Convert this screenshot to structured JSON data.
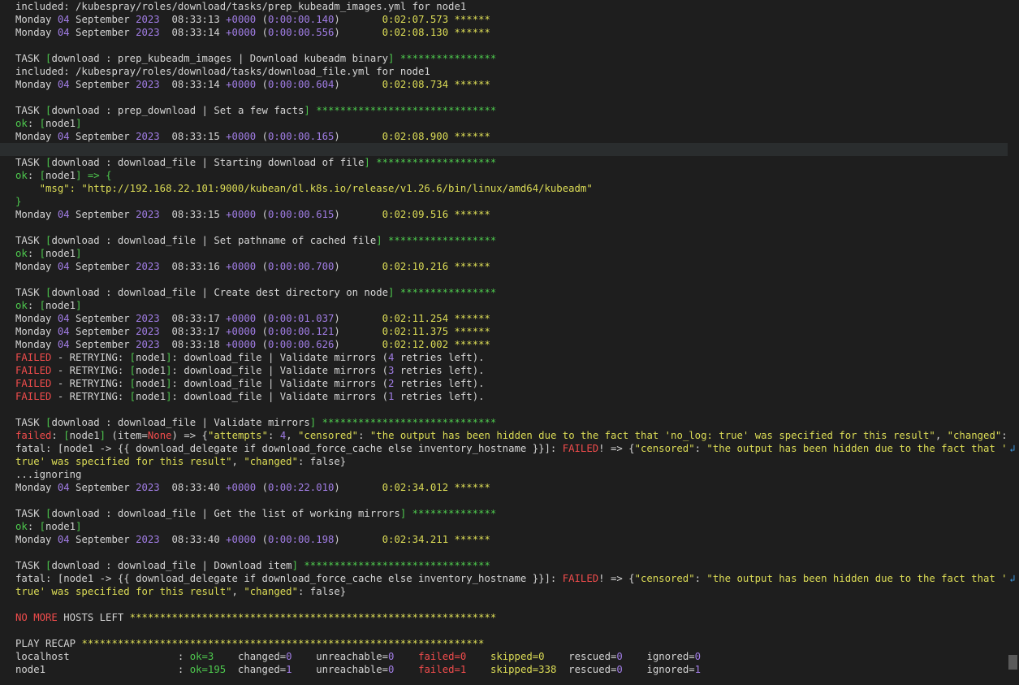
{
  "palette": {
    "default": "#d4d4d4",
    "green": "#4ec94e",
    "yellow": "#dcdc56",
    "purple": "#a17de5",
    "blue": "#3a96dd",
    "red": "#f14c4c",
    "orange": "#ce9178"
  },
  "wrap_glyph": "↲",
  "lines": [
    [
      [
        "d",
        "included: /kubespray/roles/download/tasks/prep_kubeadm_images.yml for node1"
      ]
    ],
    [
      [
        "d",
        "Monday "
      ],
      [
        "p",
        "04"
      ],
      [
        "d",
        " September "
      ],
      [
        "p",
        "2023"
      ],
      [
        "d",
        "  08:33:13 "
      ],
      [
        "p",
        "+0000"
      ],
      [
        "d",
        " ("
      ],
      [
        "p",
        "0:00:00.140"
      ],
      [
        "d",
        ")       "
      ],
      [
        "y",
        "0:02:07.573 ******"
      ]
    ],
    [
      [
        "d",
        "Monday "
      ],
      [
        "p",
        "04"
      ],
      [
        "d",
        " September "
      ],
      [
        "p",
        "2023"
      ],
      [
        "d",
        "  08:33:14 "
      ],
      [
        "p",
        "+0000"
      ],
      [
        "d",
        " ("
      ],
      [
        "p",
        "0:00:00.556"
      ],
      [
        "d",
        ")       "
      ],
      [
        "y",
        "0:02:08.130 ******"
      ]
    ],
    [],
    [
      [
        "d",
        "TASK "
      ],
      [
        "g",
        "["
      ],
      [
        "d",
        "download : prep_kubeadm_images | Download kubeadm binary"
      ],
      [
        "g",
        "] ****************"
      ]
    ],
    [
      [
        "d",
        "included: /kubespray/roles/download/tasks/download_file.yml for node1"
      ]
    ],
    [
      [
        "d",
        "Monday "
      ],
      [
        "p",
        "04"
      ],
      [
        "d",
        " September "
      ],
      [
        "p",
        "2023"
      ],
      [
        "d",
        "  08:33:14 "
      ],
      [
        "p",
        "+0000"
      ],
      [
        "d",
        " ("
      ],
      [
        "p",
        "0:00:00.604"
      ],
      [
        "d",
        ")       "
      ],
      [
        "y",
        "0:02:08.734 ******"
      ]
    ],
    [],
    [
      [
        "d",
        "TASK "
      ],
      [
        "g",
        "["
      ],
      [
        "d",
        "download : prep_download | Set a few facts"
      ],
      [
        "g",
        "] ******************************"
      ]
    ],
    [
      [
        "g",
        "ok"
      ],
      [
        "d",
        ": "
      ],
      [
        "g",
        "["
      ],
      [
        "d",
        "node1"
      ],
      [
        "g",
        "]"
      ]
    ],
    [
      [
        "d",
        "Monday "
      ],
      [
        "p",
        "04"
      ],
      [
        "d",
        " September "
      ],
      [
        "p",
        "2023"
      ],
      [
        "d",
        "  08:33:15 "
      ],
      [
        "p",
        "+0000"
      ],
      [
        "d",
        " ("
      ],
      [
        "p",
        "0:00:00.165"
      ],
      [
        "d",
        ")       "
      ],
      [
        "y",
        "0:02:08.900 ******"
      ]
    ],
    [],
    [
      [
        "d",
        "TASK "
      ],
      [
        "g",
        "["
      ],
      [
        "d",
        "download : download_file | Starting download of file"
      ],
      [
        "g",
        "] ********************"
      ]
    ],
    [
      [
        "g",
        "ok"
      ],
      [
        "d",
        ": "
      ],
      [
        "g",
        "["
      ],
      [
        "d",
        "node1"
      ],
      [
        "g",
        "] => {"
      ]
    ],
    [
      [
        "y",
        "    \"msg\": \"http://192.168.22.101:9000/kubean/dl.k8s.io/release/v1.26.6/bin/linux/amd64/kubeadm\""
      ]
    ],
    [
      [
        "g",
        "}"
      ]
    ],
    [
      [
        "d",
        "Monday "
      ],
      [
        "p",
        "04"
      ],
      [
        "d",
        " September "
      ],
      [
        "p",
        "2023"
      ],
      [
        "d",
        "  08:33:15 "
      ],
      [
        "p",
        "+0000"
      ],
      [
        "d",
        " ("
      ],
      [
        "p",
        "0:00:00.615"
      ],
      [
        "d",
        ")       "
      ],
      [
        "y",
        "0:02:09.516 ******"
      ]
    ],
    [],
    [
      [
        "d",
        "TASK "
      ],
      [
        "g",
        "["
      ],
      [
        "d",
        "download : download_file | Set pathname of cached file"
      ],
      [
        "g",
        "] ******************"
      ]
    ],
    [
      [
        "g",
        "ok"
      ],
      [
        "d",
        ": "
      ],
      [
        "g",
        "["
      ],
      [
        "d",
        "node1"
      ],
      [
        "g",
        "]"
      ]
    ],
    [
      [
        "d",
        "Monday "
      ],
      [
        "p",
        "04"
      ],
      [
        "d",
        " September "
      ],
      [
        "p",
        "2023"
      ],
      [
        "d",
        "  08:33:16 "
      ],
      [
        "p",
        "+0000"
      ],
      [
        "d",
        " ("
      ],
      [
        "p",
        "0:00:00.700"
      ],
      [
        "d",
        ")       "
      ],
      [
        "y",
        "0:02:10.216 ******"
      ]
    ],
    [],
    [
      [
        "d",
        "TASK "
      ],
      [
        "g",
        "["
      ],
      [
        "d",
        "download : download_file | Create dest directory on node"
      ],
      [
        "g",
        "] ****************"
      ]
    ],
    [
      [
        "g",
        "ok"
      ],
      [
        "d",
        ": "
      ],
      [
        "g",
        "["
      ],
      [
        "d",
        "node1"
      ],
      [
        "g",
        "]"
      ]
    ],
    [
      [
        "d",
        "Monday "
      ],
      [
        "p",
        "04"
      ],
      [
        "d",
        " September "
      ],
      [
        "p",
        "2023"
      ],
      [
        "d",
        "  08:33:17 "
      ],
      [
        "p",
        "+0000"
      ],
      [
        "d",
        " ("
      ],
      [
        "p",
        "0:00:01.037"
      ],
      [
        "d",
        ")       "
      ],
      [
        "y",
        "0:02:11.254 ******"
      ]
    ],
    [
      [
        "d",
        "Monday "
      ],
      [
        "p",
        "04"
      ],
      [
        "d",
        " September "
      ],
      [
        "p",
        "2023"
      ],
      [
        "d",
        "  08:33:17 "
      ],
      [
        "p",
        "+0000"
      ],
      [
        "d",
        " ("
      ],
      [
        "p",
        "0:00:00.121"
      ],
      [
        "d",
        ")       "
      ],
      [
        "y",
        "0:02:11.375 ******"
      ]
    ],
    [
      [
        "d",
        "Monday "
      ],
      [
        "p",
        "04"
      ],
      [
        "d",
        " September "
      ],
      [
        "p",
        "2023"
      ],
      [
        "d",
        "  08:33:18 "
      ],
      [
        "p",
        "+0000"
      ],
      [
        "d",
        " ("
      ],
      [
        "p",
        "0:00:00.626"
      ],
      [
        "d",
        ")       "
      ],
      [
        "y",
        "0:02:12.002 ******"
      ]
    ],
    [
      [
        "r",
        "FAILED"
      ],
      [
        "d",
        " - RETRYING: "
      ],
      [
        "g",
        "["
      ],
      [
        "d",
        "node1"
      ],
      [
        "g",
        "]"
      ],
      [
        "d",
        ": download_file | Validate mirrors ("
      ],
      [
        "p",
        "4"
      ],
      [
        "d",
        " retries left)."
      ]
    ],
    [
      [
        "r",
        "FAILED"
      ],
      [
        "d",
        " - RETRYING: "
      ],
      [
        "g",
        "["
      ],
      [
        "d",
        "node1"
      ],
      [
        "g",
        "]"
      ],
      [
        "d",
        ": download_file | Validate mirrors ("
      ],
      [
        "p",
        "3"
      ],
      [
        "d",
        " retries left)."
      ]
    ],
    [
      [
        "r",
        "FAILED"
      ],
      [
        "d",
        " - RETRYING: "
      ],
      [
        "g",
        "["
      ],
      [
        "d",
        "node1"
      ],
      [
        "g",
        "]"
      ],
      [
        "d",
        ": download_file | Validate mirrors ("
      ],
      [
        "p",
        "2"
      ],
      [
        "d",
        " retries left)."
      ]
    ],
    [
      [
        "r",
        "FAILED"
      ],
      [
        "d",
        " - RETRYING: "
      ],
      [
        "g",
        "["
      ],
      [
        "d",
        "node1"
      ],
      [
        "g",
        "]"
      ],
      [
        "d",
        ": download_file | Validate mirrors ("
      ],
      [
        "p",
        "1"
      ],
      [
        "d",
        " retries left)."
      ]
    ],
    [],
    [
      [
        "d",
        "TASK "
      ],
      [
        "g",
        "["
      ],
      [
        "d",
        "download : download_file | Validate mirrors"
      ],
      [
        "g",
        "] *****************************"
      ]
    ],
    [
      [
        "r",
        "failed"
      ],
      [
        "d",
        ": "
      ],
      [
        "g",
        "["
      ],
      [
        "d",
        "node1"
      ],
      [
        "g",
        "]"
      ],
      [
        "d",
        " (item="
      ],
      [
        "r",
        "None"
      ],
      [
        "d",
        ") => {"
      ],
      [
        "y",
        "\"attempts\""
      ],
      [
        "d",
        ": "
      ],
      [
        "p",
        "4"
      ],
      [
        "d",
        ", "
      ],
      [
        "y",
        "\"censored\""
      ],
      [
        "d",
        ": "
      ],
      [
        "y",
        "\"the output has been hidden due to the fact that 'no_log: true' was specified for this result\""
      ],
      [
        "d",
        ", "
      ],
      [
        "y",
        "\"changed\""
      ],
      [
        "d",
        ": false}"
      ]
    ],
    [
      [
        "d",
        "fatal: [node1 -> {{ download_delegate if download_force_cache else inventory_hostname }}]: "
      ],
      [
        "r",
        "FAILED"
      ],
      [
        "d",
        "! => {"
      ],
      [
        "y",
        "\"censored\""
      ],
      [
        "d",
        ": "
      ],
      [
        "y",
        "\"the output has been hidden due to the fact that 'no_log: "
      ]
    ],
    [
      [
        "y",
        "true' was specified for this result\""
      ],
      [
        "d",
        ", "
      ],
      [
        "y",
        "\"changed\""
      ],
      [
        "d",
        ": false}"
      ]
    ],
    [
      [
        "d",
        "...ignoring"
      ]
    ],
    [
      [
        "d",
        "Monday "
      ],
      [
        "p",
        "04"
      ],
      [
        "d",
        " September "
      ],
      [
        "p",
        "2023"
      ],
      [
        "d",
        "  08:33:40 "
      ],
      [
        "p",
        "+0000"
      ],
      [
        "d",
        " ("
      ],
      [
        "p",
        "0:00:22.010"
      ],
      [
        "d",
        ")       "
      ],
      [
        "y",
        "0:02:34.012 ******"
      ]
    ],
    [],
    [
      [
        "d",
        "TASK "
      ],
      [
        "g",
        "["
      ],
      [
        "d",
        "download : download_file | Get the list of working mirrors"
      ],
      [
        "g",
        "] **************"
      ]
    ],
    [
      [
        "g",
        "ok"
      ],
      [
        "d",
        ": "
      ],
      [
        "g",
        "["
      ],
      [
        "d",
        "node1"
      ],
      [
        "g",
        "]"
      ]
    ],
    [
      [
        "d",
        "Monday "
      ],
      [
        "p",
        "04"
      ],
      [
        "d",
        " September "
      ],
      [
        "p",
        "2023"
      ],
      [
        "d",
        "  08:33:40 "
      ],
      [
        "p",
        "+0000"
      ],
      [
        "d",
        " ("
      ],
      [
        "p",
        "0:00:00.198"
      ],
      [
        "d",
        ")       "
      ],
      [
        "y",
        "0:02:34.211 ******"
      ]
    ],
    [],
    [
      [
        "d",
        "TASK "
      ],
      [
        "g",
        "["
      ],
      [
        "d",
        "download : download_file | Download item"
      ],
      [
        "g",
        "] *******************************"
      ]
    ],
    [
      [
        "d",
        "fatal: [node1 -> {{ download_delegate if download_force_cache else inventory_hostname }}]: "
      ],
      [
        "r",
        "FAILED"
      ],
      [
        "d",
        "! => {"
      ],
      [
        "y",
        "\"censored\""
      ],
      [
        "d",
        ": "
      ],
      [
        "y",
        "\"the output has been hidden due to the fact that 'no_log: "
      ]
    ],
    [
      [
        "y",
        "true' was specified for this result\""
      ],
      [
        "d",
        ", "
      ],
      [
        "y",
        "\"changed\""
      ],
      [
        "d",
        ": false}"
      ]
    ],
    [],
    [
      [
        "r",
        "NO MORE"
      ],
      [
        "d",
        " HOSTS LEFT "
      ],
      [
        "y",
        "*************************************************************"
      ]
    ],
    [],
    [
      [
        "d",
        "PLAY RECAP "
      ],
      [
        "y",
        "*******************************************************************"
      ]
    ],
    [
      [
        "d",
        "localhost                  : "
      ],
      [
        "g",
        "ok=3"
      ],
      [
        "d",
        "    changed="
      ],
      [
        "p",
        "0"
      ],
      [
        "d",
        "    unreachable="
      ],
      [
        "p",
        "0"
      ],
      [
        "d",
        "    "
      ],
      [
        "r",
        "failed=0"
      ],
      [
        "d",
        "    "
      ],
      [
        "y",
        "skipped=0"
      ],
      [
        "d",
        "    rescued="
      ],
      [
        "p",
        "0"
      ],
      [
        "d",
        "    ignored="
      ],
      [
        "p",
        "0"
      ]
    ],
    [
      [
        "d",
        "node1                      : "
      ],
      [
        "g",
        "ok=195"
      ],
      [
        "d",
        "  changed="
      ],
      [
        "p",
        "1"
      ],
      [
        "d",
        "    unreachable="
      ],
      [
        "p",
        "0"
      ],
      [
        "d",
        "    "
      ],
      [
        "r",
        "failed=1"
      ],
      [
        "d",
        "    "
      ],
      [
        "y",
        "skipped=338"
      ],
      [
        "d",
        "  rescued="
      ],
      [
        "p",
        "0"
      ],
      [
        "d",
        "    ignored="
      ],
      [
        "p",
        "1"
      ]
    ]
  ]
}
